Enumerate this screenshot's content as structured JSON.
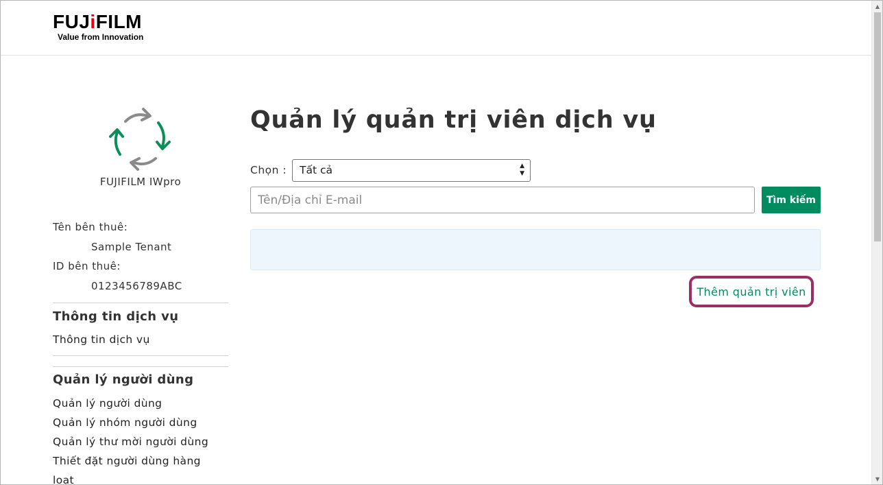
{
  "header": {
    "logo": {
      "brand_pre": "FUJ",
      "brand_i": "i",
      "brand_post": "FILM",
      "tagline": "Value from Innovation"
    }
  },
  "sidebar": {
    "app_icon": "recycle-arrows-icon",
    "app_name": "FUJIFILM IWpro",
    "tenant_name_label": "Tên bên thuê:",
    "tenant_name_value": "Sample Tenant",
    "tenant_id_label": "ID bên thuê:",
    "tenant_id_value": "0123456789ABC",
    "sections": [
      {
        "title": "Thông tin dịch vụ",
        "items": [
          {
            "label": "Thông tin dịch vụ"
          }
        ]
      },
      {
        "title": "Quản lý người dùng",
        "items": [
          {
            "label": "Quản lý người dùng"
          },
          {
            "label": "Quản lý nhóm người dùng"
          },
          {
            "label": "Quản lý thư mời người dùng"
          },
          {
            "label": "Thiết đặt người dùng hàng"
          },
          {
            "label": "loạt"
          }
        ]
      }
    ]
  },
  "main": {
    "title": "Quản lý quản trị viên dịch vụ",
    "filter": {
      "label": "Chọn :",
      "selected": "Tất cả"
    },
    "search": {
      "placeholder": "Tên/Địa chỉ E-mail",
      "value": "",
      "button_label": "Tìm kiếm"
    },
    "add_admin_label": "Thêm quản trị viên"
  },
  "colors": {
    "accent_green": "#008c5f",
    "highlight_border": "#9b2e62",
    "info_panel_bg": "#edf6fd",
    "logo_red": "#e60012"
  }
}
